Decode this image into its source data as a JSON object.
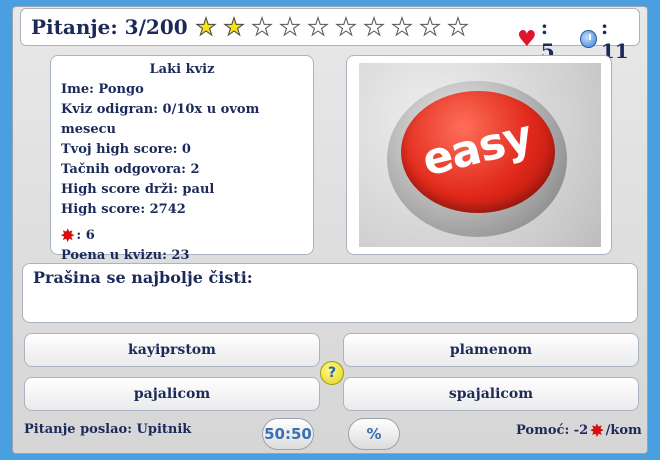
{
  "header": {
    "question_counter": "Pitanje: 3/200",
    "stars": {
      "filled": 2,
      "total": 10
    },
    "lives": "5",
    "time": "11"
  },
  "quiz_info": {
    "title": "Laki kviz",
    "name": "Ime: Pongo",
    "played": "Kviz odigran: 0/10x u ovom mesecu",
    "your_high_score": "Tvoj high score: 0",
    "correct_answers": "Tačnih odgovora: 2",
    "high_score_holder": "High score drži: paul",
    "high_score": "High score: 2742",
    "fire_count": ": 6",
    "points": "Poena u kvizu: 23"
  },
  "image": {
    "caption_text": "easy",
    "colors": {
      "button": "#e0281a",
      "text": "#ffffff"
    }
  },
  "question": {
    "text": "Prašina se najbolje čisti:"
  },
  "answers": [
    {
      "label": "kayiprstom"
    },
    {
      "label": "plamenom"
    },
    {
      "label": "pajalicom"
    },
    {
      "label": "spajalicom"
    }
  ],
  "footer": {
    "sent_by": "Pitanje poslao: Upitnik",
    "fifty_fifty": "50:50",
    "percent": "%",
    "help_prefix": "Pomoć: -2",
    "help_suffix": "/kom"
  },
  "icons": {
    "heart": "heart-icon",
    "clock": "clock-icon",
    "fire": "fire-joker-icon",
    "help": "question-help-icon"
  },
  "colors": {
    "background": "#4a9fe0",
    "text": "#1c2a5a",
    "star_filled": "#f6e31c",
    "heart": "#e0142a"
  }
}
